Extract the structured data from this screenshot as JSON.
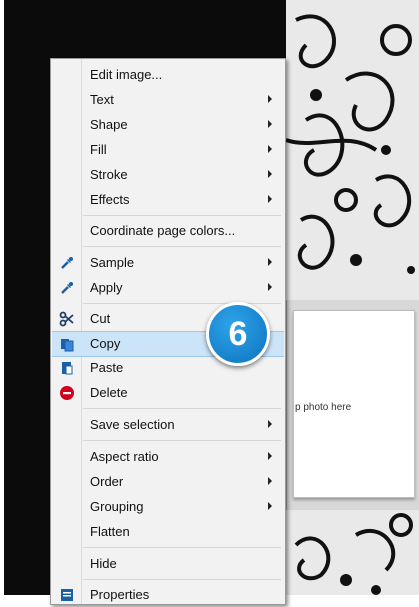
{
  "menu": {
    "items": [
      {
        "label": "Edit image...",
        "submenu": false
      },
      {
        "label": "Text",
        "submenu": true
      },
      {
        "label": "Shape",
        "submenu": true
      },
      {
        "label": "Fill",
        "submenu": true
      },
      {
        "label": "Stroke",
        "submenu": true
      },
      {
        "label": "Effects",
        "submenu": true
      },
      {
        "label": "Coordinate page colors...",
        "submenu": false
      },
      {
        "label": "Sample",
        "submenu": true
      },
      {
        "label": "Apply",
        "submenu": true
      },
      {
        "label": "Cut",
        "submenu": false
      },
      {
        "label": "Copy",
        "submenu": false
      },
      {
        "label": "Paste",
        "submenu": false
      },
      {
        "label": "Delete",
        "submenu": false
      },
      {
        "label": "Save selection",
        "submenu": true
      },
      {
        "label": "Aspect ratio",
        "submenu": true
      },
      {
        "label": "Order",
        "submenu": true
      },
      {
        "label": "Grouping",
        "submenu": true
      },
      {
        "label": "Flatten",
        "submenu": false
      },
      {
        "label": "Hide",
        "submenu": false
      },
      {
        "label": "Properties",
        "submenu": false
      }
    ]
  },
  "canvas": {
    "photo_placeholder_text": "p photo here"
  },
  "badge": {
    "number": "6"
  },
  "colors": {
    "highlight": "#cce4f7",
    "badge": "#1a86d0",
    "delete_icon": "#d0021b",
    "background": "#0b0b0b"
  }
}
